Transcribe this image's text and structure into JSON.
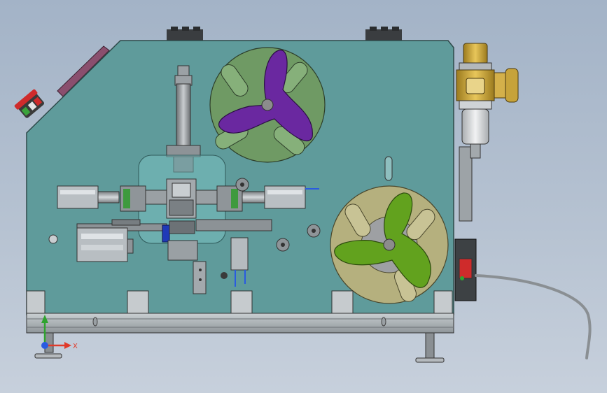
{
  "viewport": {
    "background_top": "#a3b3c7",
    "background_bottom": "#c7d0dc"
  },
  "machine": {
    "panel_color": "#5f9b9b",
    "panel_edge": "#2e4a4a",
    "frame_color": "#a9b0b3",
    "reel_upper_disc": "#6f9a64",
    "reel_upper_hub": "#6a28a0",
    "reel_lower_disc": "#b5b07e",
    "reel_lower_hub": "#62a21e",
    "regulator_body": "#d8d8d8",
    "regulator_brass": "#c7a33a",
    "estop_color": "#cf2b2b"
  },
  "triad": {
    "x_label": "X",
    "x_color": "#e03a2a",
    "y_color": "#2fa32f",
    "z_color": "#2a5be0",
    "icon": "coordinate-triad-icon"
  },
  "icons": {
    "estop": "emergency-stop-icon",
    "regulator": "air-regulator-icon",
    "cable": "power-cable-icon"
  }
}
